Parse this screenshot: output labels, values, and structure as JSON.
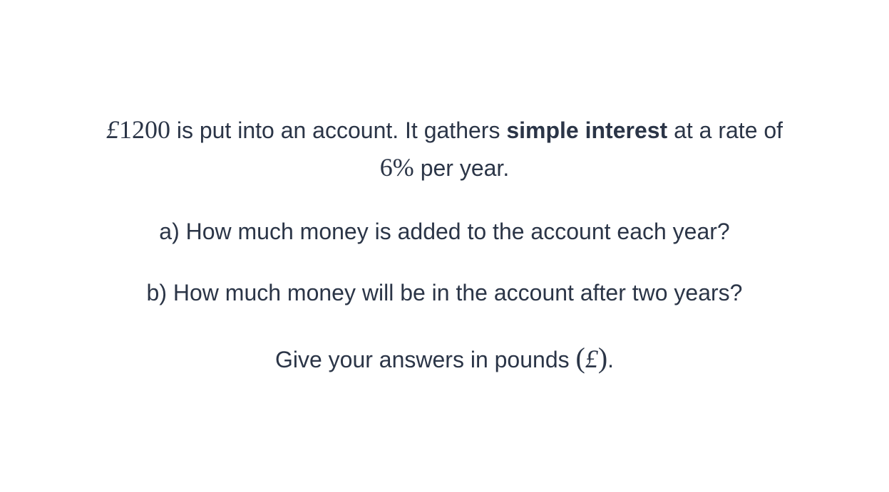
{
  "question": {
    "intro": {
      "currency_symbol": "£",
      "principal": "1200",
      "text_before_bold": " is put into an account. It gathers ",
      "bold_term": "simple interest",
      "text_after_bold": " at a rate of",
      "rate": "6%",
      "text_end": " per year."
    },
    "part_a": "a) How much money is added to the account each year?",
    "part_b": "b) How much money will be in the account after two years?",
    "instruction": {
      "text": "Give your answers in pounds ",
      "open_paren": "(",
      "symbol": "£",
      "close_paren": ")",
      "end": "."
    }
  }
}
